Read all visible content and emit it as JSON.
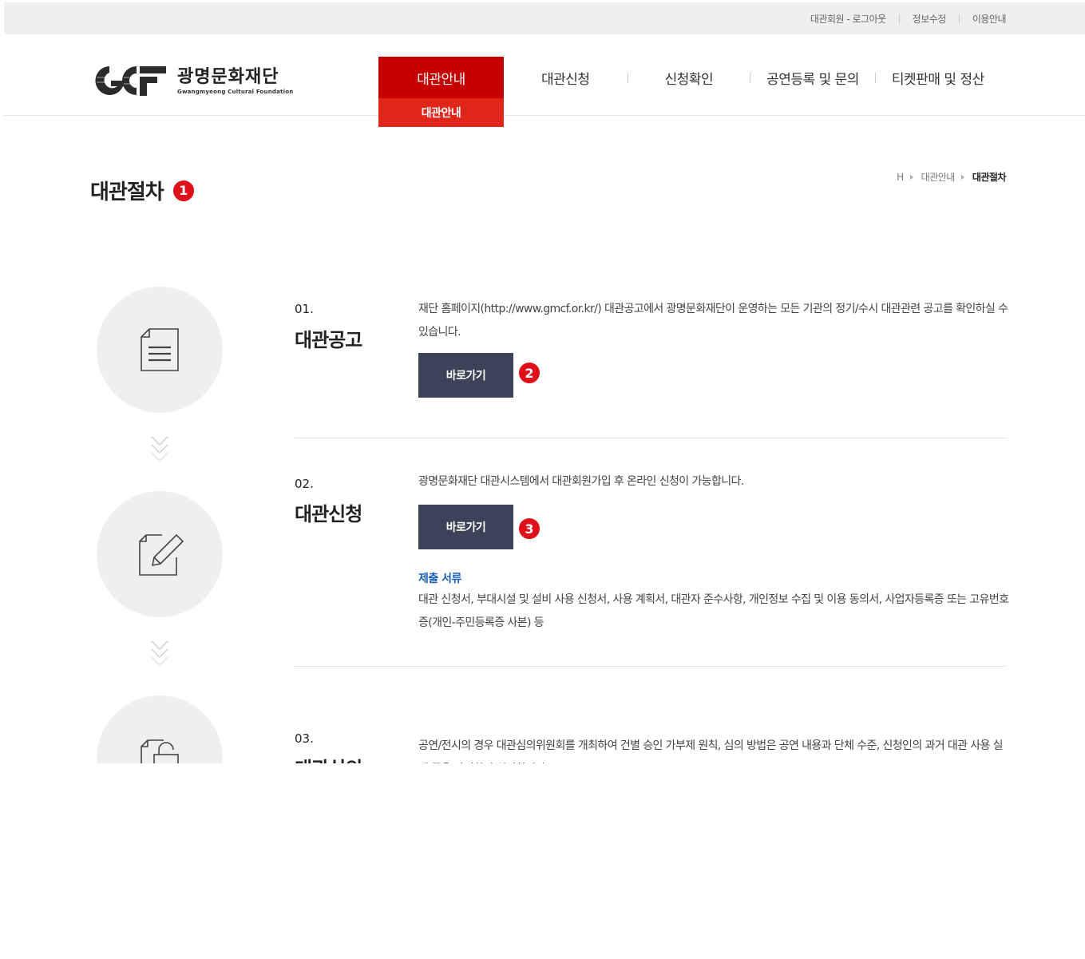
{
  "topbar": {
    "links": [
      "대관회원 - 로그아웃",
      "정보수정",
      "이용안내"
    ]
  },
  "logo": {
    "name_ko": "광명문화재단",
    "name_en": "Gwangmyeong Cultural Foundation"
  },
  "gnb": {
    "items": [
      "대관안내",
      "대관신청",
      "신청확인",
      "공연등록 및 문의",
      "티켓판매 및 정산"
    ],
    "active_index": 0,
    "submenu": "대관안내"
  },
  "page": {
    "title": "대관절차",
    "title_badge": "1"
  },
  "breadcrumb": {
    "home": "H",
    "parent": "대관안내",
    "current": "대관절차"
  },
  "steps": [
    {
      "num": "01.",
      "title": "대관공고",
      "desc": "재단 홈페이지(http://www.gmcf.or.kr/) 대관공고에서 광명문화재단이 운영하는 모든 기관의 정기/수시 대관관련 공고를 확인하실 수 있습니다.",
      "button": "바로가기",
      "button_badge": "2",
      "icon": "document-icon"
    },
    {
      "num": "02.",
      "title": "대관신청",
      "desc": "광명문화재단 대관시스템에서 대관회원가입 후 온라인 신청이 가능합니다.",
      "button": "바로가기",
      "button_badge": "3",
      "docs_title": "제출 서류",
      "docs_desc": "대관 신청서, 부대시설 및 설비 사용 신청서, 사용 계획서, 대관자 준수사항, 개인정보 수집 및 이용 동의서, 사업자등록증 또는 고유번호증(개인-주민등록증 사본) 등",
      "icon": "edit-icon"
    },
    {
      "num": "03.",
      "title": "대관심의",
      "desc": "공연/전시의 경우 대관심의위원회를 개최하여 건별 승인 가부제 원칙, 심의 방법은 공연 내용과 단체 수준, 신청인의 과거 대관 사용 실태 등을 반영하여 심의합니다.",
      "icon": "unlock-icon"
    }
  ],
  "colors": {
    "brand_red": "#c60000",
    "sub_red": "#e0261a",
    "badge_red": "#e0101a",
    "button_navy": "#3c4258",
    "docs_blue": "#1a5fb4"
  }
}
